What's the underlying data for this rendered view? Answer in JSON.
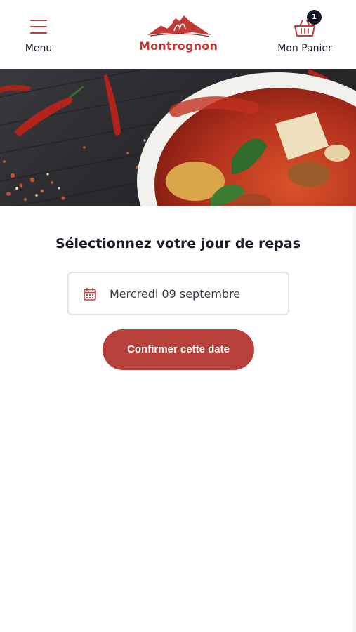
{
  "header": {
    "menu_label": "Menu",
    "logo_text": "Montrognon",
    "cart_label": "Mon Panier",
    "cart_count": "1"
  },
  "hero": {
    "description_icon": "food-photo"
  },
  "main": {
    "title": "Sélectionnez votre jour de repas",
    "date_value": "Mercredi 09 septembre",
    "confirm_label": "Confirmer cette date"
  },
  "colors": {
    "accent": "#b8403a",
    "brand": "#c23a33",
    "badge": "#17172a",
    "text": "#1b1b2a"
  },
  "icons": {
    "menu": "hamburger-icon",
    "cart": "basket-icon",
    "date": "calendar-icon"
  }
}
